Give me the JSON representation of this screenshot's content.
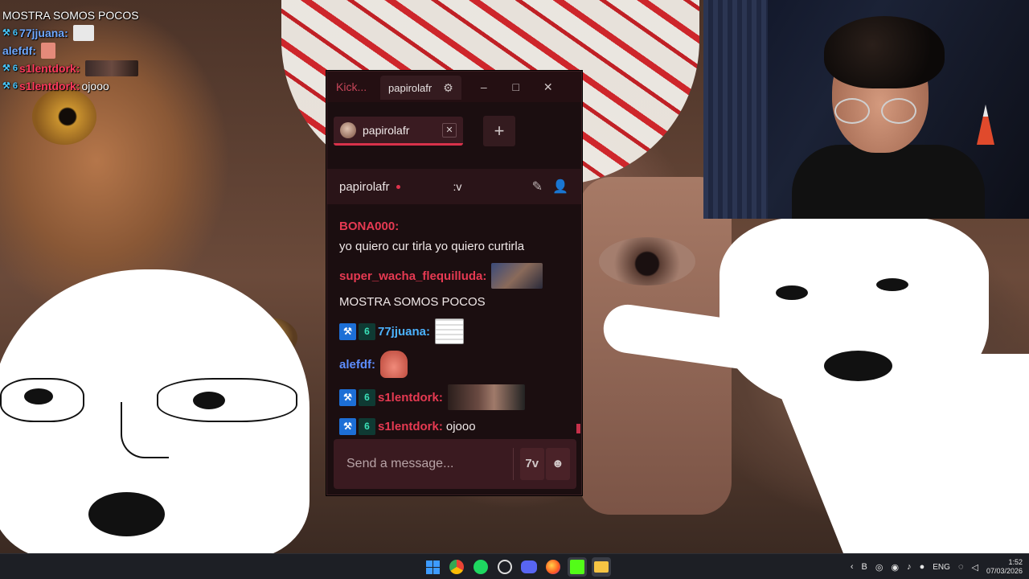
{
  "overlay": {
    "lines": [
      {
        "text": "MOSTRA SOMOS POCOS"
      },
      {
        "user": "77jjuana:",
        "badge": "⚒ 6"
      },
      {
        "user": "alefdf:"
      },
      {
        "user": "s1lentdork:",
        "badge": "⚒ 6"
      },
      {
        "user": "s1lentdork:",
        "badge": "⚒ 6",
        "text": "ojooo"
      }
    ]
  },
  "window": {
    "title": "Kick...",
    "tab_label": "papirolafr",
    "controls": {
      "settings": "⚙",
      "minimize": "–",
      "maximize": "□",
      "close": "✕"
    }
  },
  "channel_tabs": {
    "active": {
      "name": "papirolafr",
      "close": "✕"
    },
    "add": "+"
  },
  "channel_header": {
    "name": "papirolafr",
    "stream_title": ":v",
    "icons": [
      "pin-icon",
      "user-icon"
    ]
  },
  "messages": [
    {
      "user": "BONA000:",
      "text": "yo quiero cur tirla yo quiero curtirla",
      "color": "#e63a52"
    },
    {
      "user": "super_wacha_flequilluda:",
      "emote": "photo",
      "color": "#e63a52"
    },
    {
      "text": "MOSTRA SOMOS POCOS"
    },
    {
      "user": "77jjuana:",
      "badges": [
        "⚒",
        "6"
      ],
      "emote": "meme",
      "color": "#4bb2ff"
    },
    {
      "user": "alefdf:",
      "emote": "patrick",
      "color": "#5d8dff"
    },
    {
      "user": "s1lentdork:",
      "badges": [
        "⚒",
        "6"
      ],
      "emote": "wide",
      "color": "#e63a52"
    },
    {
      "user": "s1lentdork:",
      "badges": [
        "⚒",
        "6"
      ],
      "text": "ojooo",
      "color": "#e63a52"
    }
  ],
  "composer": {
    "placeholder": "Send a message...",
    "emote_button": "7v",
    "kick_emote_button": "☻"
  },
  "taskbar": {
    "apps": [
      "windows-start",
      "chrome",
      "spotify",
      "obs",
      "discord",
      "firefox",
      "kick",
      "file-explorer"
    ],
    "tray": {
      "lang": "ENG",
      "time": "1:52",
      "date": "07/03/2026"
    }
  },
  "colors": {
    "accent": "#e63a52",
    "window_bg": "#1b0e10",
    "taskbar_bg": "#1d1f25"
  }
}
